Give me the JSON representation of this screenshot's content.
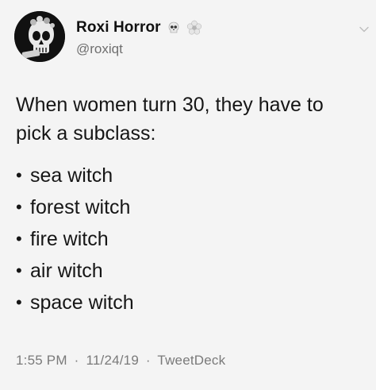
{
  "author": {
    "display_name": "Roxi Horror",
    "handle": "@roxiqt",
    "emojis": [
      "skull-emoji",
      "flower-emoji"
    ]
  },
  "tweet": {
    "text_line_1": "When women turn 30, they have to",
    "text_line_2": "pick a subclass:",
    "list_items": [
      {
        "bullet": "•",
        "label": "sea witch"
      },
      {
        "bullet": "•",
        "label": "forest witch"
      },
      {
        "bullet": "•",
        "label": "fire witch"
      },
      {
        "bullet": "•",
        "label": "air witch"
      },
      {
        "bullet": "•",
        "label": "space witch"
      }
    ]
  },
  "meta": {
    "time": "1:55 PM",
    "separator": "·",
    "date": "11/24/19",
    "source": "TweetDeck"
  },
  "icons": {
    "avatar": "skull-avatar-icon",
    "more": "chevron-down-icon"
  }
}
